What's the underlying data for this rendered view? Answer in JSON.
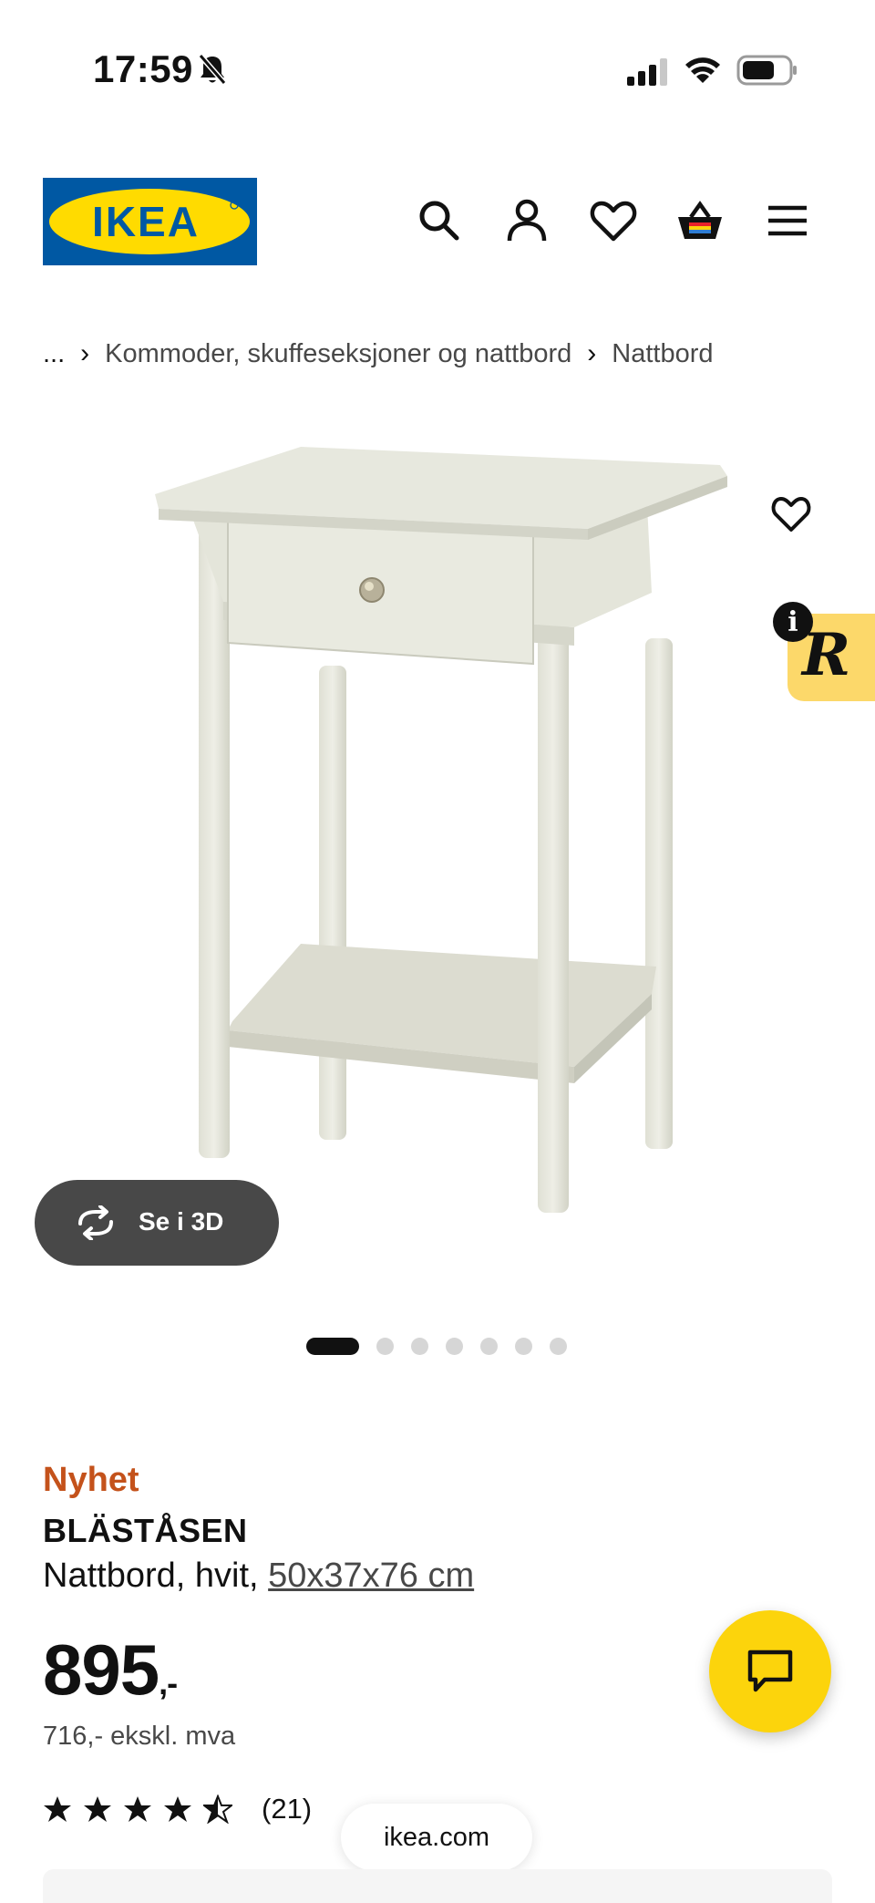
{
  "status_bar": {
    "time": "17:59"
  },
  "header": {
    "logo_text": "IKEA",
    "icons": [
      "search-icon",
      "user-icon",
      "heart-icon",
      "basket-icon",
      "menu-icon"
    ],
    "colors": {
      "logo_blue": "#0058a3",
      "logo_yellow": "#ffdb00"
    }
  },
  "breadcrumb": {
    "ellipsis": "...",
    "items": [
      "Kommoder, skuffeseksjoner og nattbord",
      "Nattbord"
    ]
  },
  "gallery": {
    "view_3d_label": "Se i 3D",
    "dot_count": 7,
    "active_index": 0
  },
  "product": {
    "badge": "Nyhet",
    "name": "BLÄSTÅSEN",
    "description": "Nattbord, hvit,",
    "size": "50x37x76 cm",
    "price": "895",
    "price_suffix": ",-",
    "price_ex_vat": "716,- ekskl. mva",
    "rating_stars": 4.5,
    "rating_count": "(21)",
    "colors": {
      "badge": "#c4521b",
      "chat_button": "#fcd40c"
    }
  },
  "browser": {
    "url": "ikea.com"
  }
}
